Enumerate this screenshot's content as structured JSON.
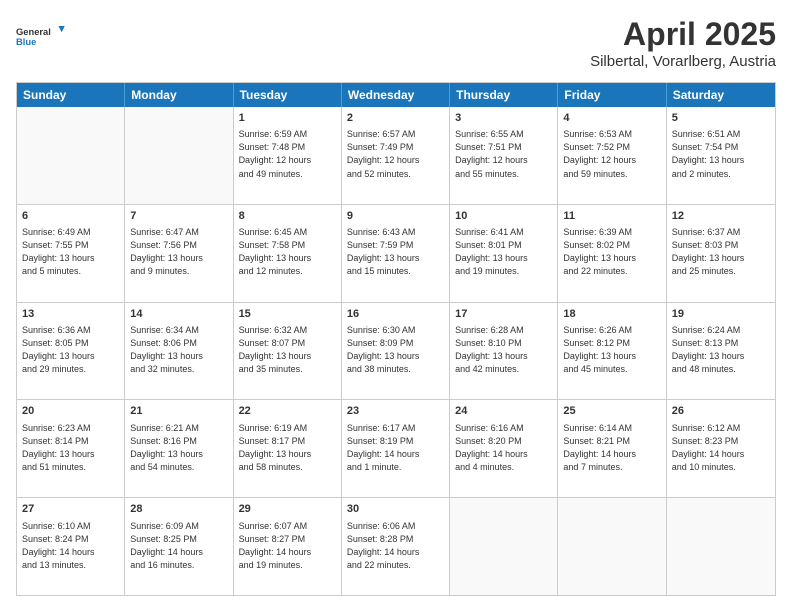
{
  "header": {
    "logo_line1": "General",
    "logo_line2": "Blue",
    "title": "April 2025",
    "subtitle": "Silbertal, Vorarlberg, Austria"
  },
  "calendar": {
    "days_of_week": [
      "Sunday",
      "Monday",
      "Tuesday",
      "Wednesday",
      "Thursday",
      "Friday",
      "Saturday"
    ],
    "rows": [
      [
        {
          "day": "",
          "info": ""
        },
        {
          "day": "",
          "info": ""
        },
        {
          "day": "1",
          "info": "Sunrise: 6:59 AM\nSunset: 7:48 PM\nDaylight: 12 hours\nand 49 minutes."
        },
        {
          "day": "2",
          "info": "Sunrise: 6:57 AM\nSunset: 7:49 PM\nDaylight: 12 hours\nand 52 minutes."
        },
        {
          "day": "3",
          "info": "Sunrise: 6:55 AM\nSunset: 7:51 PM\nDaylight: 12 hours\nand 55 minutes."
        },
        {
          "day": "4",
          "info": "Sunrise: 6:53 AM\nSunset: 7:52 PM\nDaylight: 12 hours\nand 59 minutes."
        },
        {
          "day": "5",
          "info": "Sunrise: 6:51 AM\nSunset: 7:54 PM\nDaylight: 13 hours\nand 2 minutes."
        }
      ],
      [
        {
          "day": "6",
          "info": "Sunrise: 6:49 AM\nSunset: 7:55 PM\nDaylight: 13 hours\nand 5 minutes."
        },
        {
          "day": "7",
          "info": "Sunrise: 6:47 AM\nSunset: 7:56 PM\nDaylight: 13 hours\nand 9 minutes."
        },
        {
          "day": "8",
          "info": "Sunrise: 6:45 AM\nSunset: 7:58 PM\nDaylight: 13 hours\nand 12 minutes."
        },
        {
          "day": "9",
          "info": "Sunrise: 6:43 AM\nSunset: 7:59 PM\nDaylight: 13 hours\nand 15 minutes."
        },
        {
          "day": "10",
          "info": "Sunrise: 6:41 AM\nSunset: 8:01 PM\nDaylight: 13 hours\nand 19 minutes."
        },
        {
          "day": "11",
          "info": "Sunrise: 6:39 AM\nSunset: 8:02 PM\nDaylight: 13 hours\nand 22 minutes."
        },
        {
          "day": "12",
          "info": "Sunrise: 6:37 AM\nSunset: 8:03 PM\nDaylight: 13 hours\nand 25 minutes."
        }
      ],
      [
        {
          "day": "13",
          "info": "Sunrise: 6:36 AM\nSunset: 8:05 PM\nDaylight: 13 hours\nand 29 minutes."
        },
        {
          "day": "14",
          "info": "Sunrise: 6:34 AM\nSunset: 8:06 PM\nDaylight: 13 hours\nand 32 minutes."
        },
        {
          "day": "15",
          "info": "Sunrise: 6:32 AM\nSunset: 8:07 PM\nDaylight: 13 hours\nand 35 minutes."
        },
        {
          "day": "16",
          "info": "Sunrise: 6:30 AM\nSunset: 8:09 PM\nDaylight: 13 hours\nand 38 minutes."
        },
        {
          "day": "17",
          "info": "Sunrise: 6:28 AM\nSunset: 8:10 PM\nDaylight: 13 hours\nand 42 minutes."
        },
        {
          "day": "18",
          "info": "Sunrise: 6:26 AM\nSunset: 8:12 PM\nDaylight: 13 hours\nand 45 minutes."
        },
        {
          "day": "19",
          "info": "Sunrise: 6:24 AM\nSunset: 8:13 PM\nDaylight: 13 hours\nand 48 minutes."
        }
      ],
      [
        {
          "day": "20",
          "info": "Sunrise: 6:23 AM\nSunset: 8:14 PM\nDaylight: 13 hours\nand 51 minutes."
        },
        {
          "day": "21",
          "info": "Sunrise: 6:21 AM\nSunset: 8:16 PM\nDaylight: 13 hours\nand 54 minutes."
        },
        {
          "day": "22",
          "info": "Sunrise: 6:19 AM\nSunset: 8:17 PM\nDaylight: 13 hours\nand 58 minutes."
        },
        {
          "day": "23",
          "info": "Sunrise: 6:17 AM\nSunset: 8:19 PM\nDaylight: 14 hours\nand 1 minute."
        },
        {
          "day": "24",
          "info": "Sunrise: 6:16 AM\nSunset: 8:20 PM\nDaylight: 14 hours\nand 4 minutes."
        },
        {
          "day": "25",
          "info": "Sunrise: 6:14 AM\nSunset: 8:21 PM\nDaylight: 14 hours\nand 7 minutes."
        },
        {
          "day": "26",
          "info": "Sunrise: 6:12 AM\nSunset: 8:23 PM\nDaylight: 14 hours\nand 10 minutes."
        }
      ],
      [
        {
          "day": "27",
          "info": "Sunrise: 6:10 AM\nSunset: 8:24 PM\nDaylight: 14 hours\nand 13 minutes."
        },
        {
          "day": "28",
          "info": "Sunrise: 6:09 AM\nSunset: 8:25 PM\nDaylight: 14 hours\nand 16 minutes."
        },
        {
          "day": "29",
          "info": "Sunrise: 6:07 AM\nSunset: 8:27 PM\nDaylight: 14 hours\nand 19 minutes."
        },
        {
          "day": "30",
          "info": "Sunrise: 6:06 AM\nSunset: 8:28 PM\nDaylight: 14 hours\nand 22 minutes."
        },
        {
          "day": "",
          "info": ""
        },
        {
          "day": "",
          "info": ""
        },
        {
          "day": "",
          "info": ""
        }
      ]
    ]
  }
}
